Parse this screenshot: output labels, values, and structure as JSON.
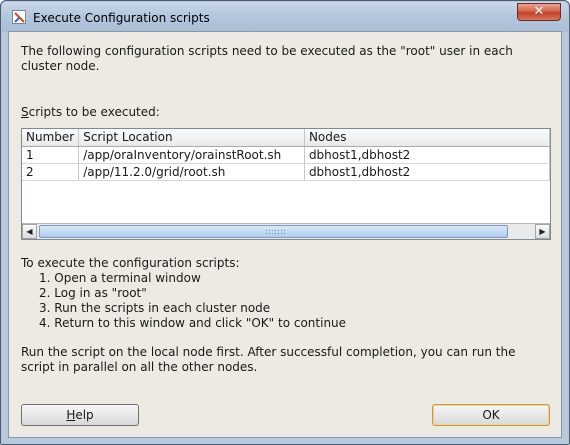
{
  "window": {
    "title": "Execute Configuration scripts",
    "close_glyph": "✕"
  },
  "intro_text": "The following configuration scripts need to be executed as the \"root\" user in each cluster node.",
  "scripts_label_mnemonic": "S",
  "scripts_label_rest": "cripts to be executed:",
  "table": {
    "columns": [
      "Number",
      "Script Location",
      "Nodes"
    ],
    "rows": [
      [
        "1",
        "/app/oraInventory/orainstRoot.sh",
        "dbhost1,dbhost2"
      ],
      [
        "2",
        "/app/11.2.0/grid/root.sh",
        "dbhost1,dbhost2"
      ]
    ]
  },
  "scrollbar": {
    "left_arrow": "◀",
    "right_arrow": "▶"
  },
  "instructions": {
    "title": "To execute the configuration scripts:",
    "steps": [
      "1. Open a terminal window",
      "2. Log in as \"root\"",
      "3. Run the scripts in each cluster node",
      "4. Return to this window and click \"OK\" to continue"
    ]
  },
  "final_note": "Run the script on the local node first. After successful completion, you can run the script in parallel on all the other nodes.",
  "buttons": {
    "help_mnemonic": "H",
    "help_rest": "elp",
    "ok": "OK"
  },
  "icons": {
    "title_icon": "oracle-installer-icon",
    "close_icon": "close-icon"
  }
}
